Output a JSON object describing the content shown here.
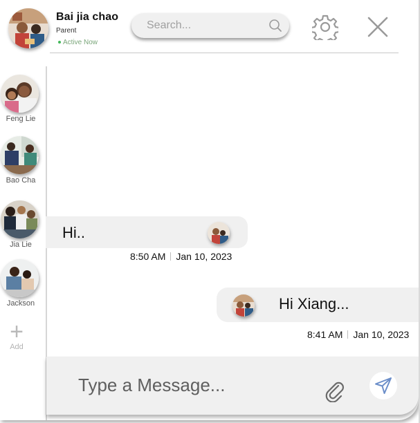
{
  "header": {
    "user_name": "Bai jia chao",
    "user_role": "Parent",
    "status": "Active Now",
    "avatar_icon": "family-photo-avatar"
  },
  "search": {
    "placeholder": "Search...",
    "icon": "search-icon"
  },
  "toolbar": {
    "settings_icon": "gear-icon",
    "close_icon": "close-icon"
  },
  "contacts": [
    {
      "name": "Feng Lie",
      "icon": "avatar-photo"
    },
    {
      "name": "Bao Cha",
      "icon": "avatar-photo"
    },
    {
      "name": "Jia Lie",
      "icon": "avatar-photo"
    },
    {
      "name": "Jackson",
      "icon": "avatar-photo"
    }
  ],
  "add_contact": {
    "label": "Add",
    "icon": "plus-icon"
  },
  "messages": [
    {
      "direction": "incoming",
      "text": "Hi..",
      "time": "8:50 AM",
      "date": "Jan 10, 2023"
    },
    {
      "direction": "outgoing",
      "text": "Hi Xiang...",
      "time": "8:41 AM",
      "date": "Jan 10, 2023"
    }
  ],
  "composer": {
    "placeholder": "Type a Message...",
    "attach_icon": "paperclip-icon",
    "send_icon": "paper-plane-icon"
  },
  "colors": {
    "surface": "#f0f0f0",
    "status_dot": "#43b85a",
    "send_icon": "#6b8ec9",
    "text": "#111111"
  }
}
